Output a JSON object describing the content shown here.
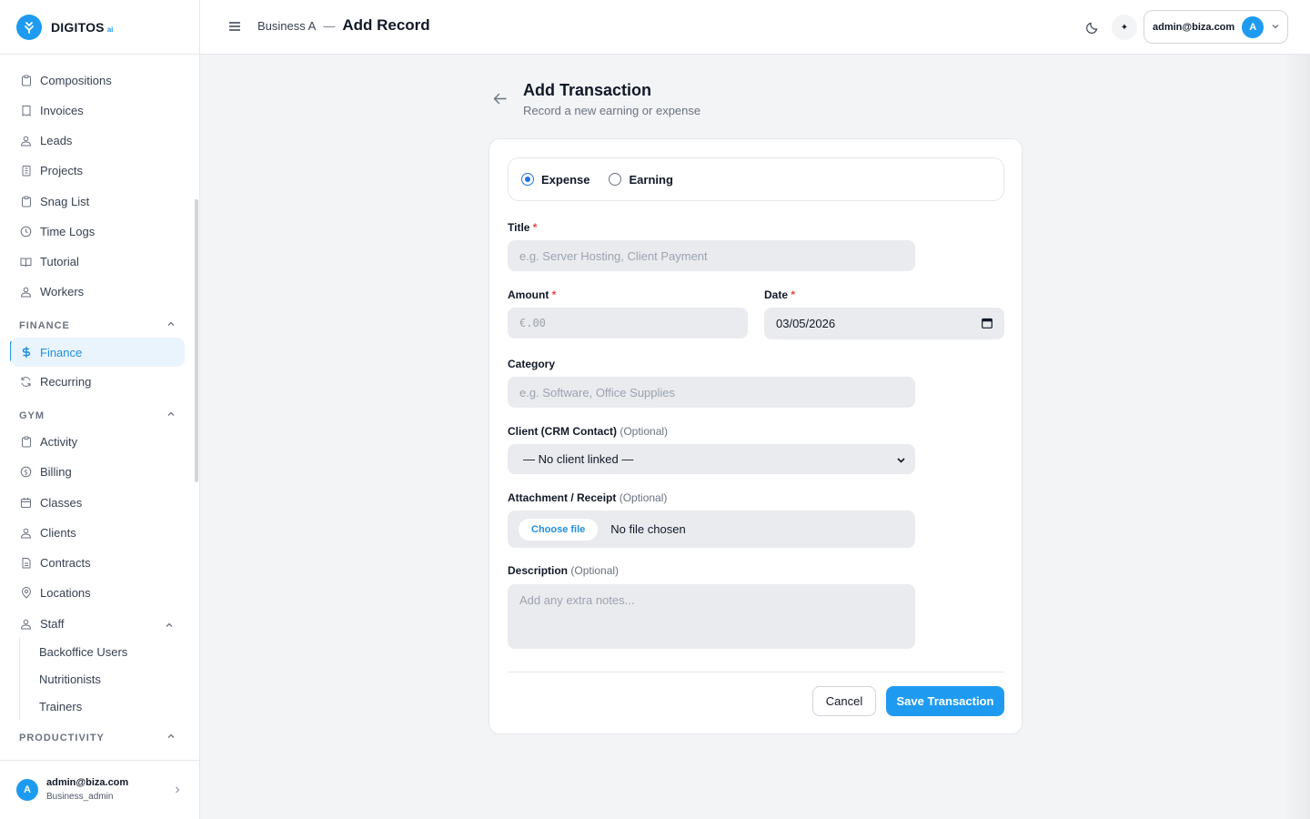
{
  "brand": {
    "name": "DIGITOS",
    "suffix": "ai"
  },
  "header": {
    "breadcrumb_parent": "Business A",
    "breadcrumb_sep": "—",
    "breadcrumb_current": "Add Record",
    "user_email": "admin@biza.com",
    "avatar_letter": "A"
  },
  "sidebar": {
    "items": [
      {
        "label": "Compositions",
        "icon": "clipboard-icon"
      },
      {
        "label": "Invoices",
        "icon": "receipt-icon"
      },
      {
        "label": "Leads",
        "icon": "users-icon"
      },
      {
        "label": "Projects",
        "icon": "building-icon"
      },
      {
        "label": "Snag List",
        "icon": "clipboard-icon"
      },
      {
        "label": "Time Logs",
        "icon": "clock-icon"
      },
      {
        "label": "Tutorial",
        "icon": "book-icon"
      },
      {
        "label": "Workers",
        "icon": "users-icon"
      }
    ],
    "finance_section": "FINANCE",
    "finance_items": [
      {
        "label": "Finance",
        "icon": "dollar-icon",
        "active": true
      },
      {
        "label": "Recurring",
        "icon": "refresh-icon"
      }
    ],
    "gym_section": "GYM",
    "gym_items": [
      {
        "label": "Activity",
        "icon": "clipboard-icon"
      },
      {
        "label": "Billing",
        "icon": "coin-icon"
      },
      {
        "label": "Classes",
        "icon": "calendar-icon"
      },
      {
        "label": "Clients",
        "icon": "users-icon"
      },
      {
        "label": "Contracts",
        "icon": "document-icon"
      },
      {
        "label": "Locations",
        "icon": "map-pin-icon"
      },
      {
        "label": "Staff",
        "icon": "users-icon"
      }
    ],
    "staff_sub": [
      "Backoffice Users",
      "Nutritionists",
      "Trainers"
    ],
    "productivity_section": "PRODUCTIVITY",
    "footer": {
      "email": "admin@biza.com",
      "role": "Business_admin",
      "avatar_letter": "A"
    }
  },
  "page": {
    "title": "Add Transaction",
    "subtitle": "Record a new earning or expense"
  },
  "form": {
    "type_options": [
      {
        "label": "Expense",
        "checked": true
      },
      {
        "label": "Earning",
        "checked": false
      }
    ],
    "title_label": "Title",
    "title_req": "*",
    "title_placeholder": "e.g. Server Hosting, Client Payment",
    "amount_label": "Amount",
    "amount_req": "*",
    "amount_placeholder": "€.00",
    "date_label": "Date",
    "date_req": "*",
    "date_value": "03/05/2026",
    "category_label": "Category",
    "category_placeholder": "e.g. Software, Office Supplies",
    "client_label": "Client (CRM Contact)",
    "client_optional": "(Optional)",
    "client_value": "— No client linked —",
    "attachment_label": "Attachment / Receipt",
    "attachment_optional": "(Optional)",
    "file_button": "Choose file",
    "file_status": "No file chosen",
    "description_label": "Description",
    "description_optional": "(Optional)",
    "description_placeholder": "Add any extra notes...",
    "cancel_label": "Cancel",
    "save_label": "Save Transaction"
  },
  "colors": {
    "accent": "#1e9bf0",
    "radio": "#1e73e8",
    "required": "#ef4444",
    "field_bg": "#eaebee"
  }
}
